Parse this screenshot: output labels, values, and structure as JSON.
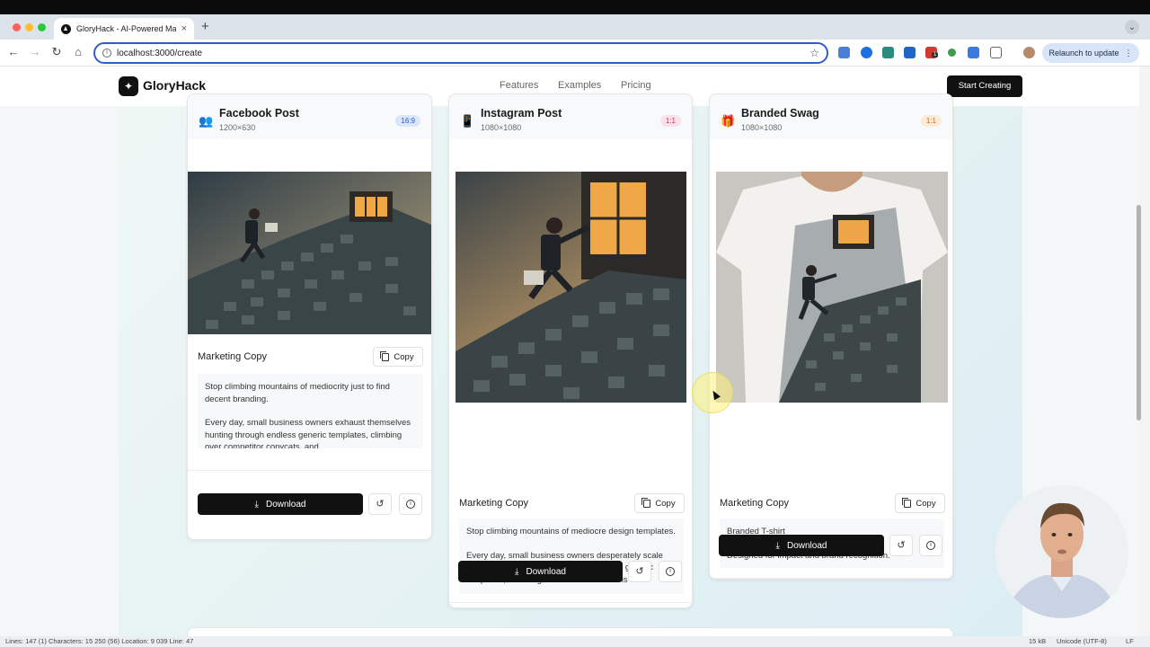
{
  "browser": {
    "tab_title": "GloryHack - AI-Powered Mar",
    "tab_close": "×",
    "new_tab": "+",
    "url": "localhost:3000/create",
    "relaunch_label": "Relaunch to update",
    "extension_badge": "1"
  },
  "site": {
    "brand": "GloryHack",
    "nav": [
      "Features",
      "Examples",
      "Pricing"
    ],
    "cta": "Start Creating"
  },
  "cards": [
    {
      "title": "Facebook Post",
      "dims": "1200×630",
      "ratio": "16:9",
      "icon": "people-icon",
      "copy_label": "Marketing Copy",
      "copy_button": "Copy",
      "copy_paragraphs": [
        "Stop climbing mountains of mediocrity just to find decent branding.",
        "Every day, small business owners exhaust themselves hunting through endless generic templates, climbing over competitor copycats, and"
      ],
      "download_label": "Download"
    },
    {
      "title": "Instagram Post",
      "dims": "1080×1080",
      "ratio": "1:1",
      "icon": "phone-icon",
      "copy_label": "Marketing Copy",
      "copy_button": "Copy",
      "copy_paragraphs": [
        "Stop climbing mountains of mediocre design templates.",
        "Every day, small business owners desperately scale impossible peaks of competitor logos and generic templates, clutching their business dreams while"
      ],
      "download_label": "Download"
    },
    {
      "title": "Branded Swag",
      "dims": "1080×1080",
      "ratio": "1:1",
      "icon": "gift-icon",
      "copy_label": "Marketing Copy",
      "copy_button": "Copy",
      "copy_paragraphs": [
        "Branded T-shirt",
        "Designed for impact and brand recognition."
      ],
      "download_label": "Download"
    }
  ],
  "statusbar": {
    "left": "Lines: 147 (1)   Characters: 15 250 (56)   Location: 9 039   Line: 47",
    "size": "15 kB",
    "encoding": "Unicode (UTF-8)",
    "eol": "LF"
  },
  "colors": {
    "accent_blue": "#2f5ec4",
    "badge_blue_bg": "#dbe6fb",
    "badge_pink_bg": "#fbe1ea",
    "badge_orange_bg": "#fdebd6",
    "button_dark": "#111111"
  }
}
